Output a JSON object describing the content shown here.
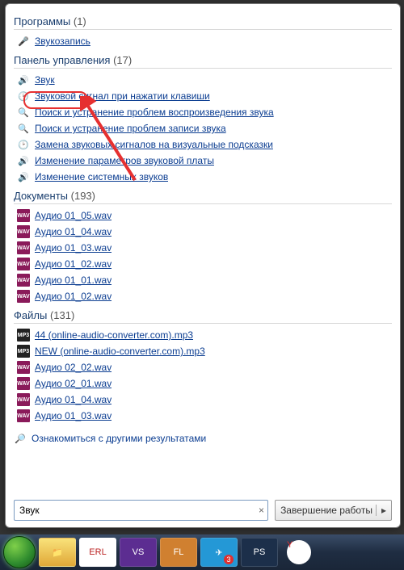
{
  "sections": {
    "programs": {
      "title": "Программы",
      "count": "(1)",
      "items": [
        {
          "icon": "mic",
          "label": "Звукозапись"
        }
      ]
    },
    "control_panel": {
      "title": "Панель управления",
      "count": "(17)",
      "items": [
        {
          "icon": "speaker",
          "label": "Звук"
        },
        {
          "icon": "clock",
          "label": "Звуковой сигнал при нажатии клавиши"
        },
        {
          "icon": "search",
          "label": "Поиск и устранение проблем воспроизведения звука"
        },
        {
          "icon": "search",
          "label": "Поиск и устранение проблем записи звука"
        },
        {
          "icon": "clock",
          "label": "Замена звуковых сигналов на визуальные подсказки"
        },
        {
          "icon": "speaker",
          "label": "Изменение параметров звуковой платы"
        },
        {
          "icon": "speaker",
          "label": "Изменение системных звуков"
        }
      ]
    },
    "documents": {
      "title": "Документы",
      "count": "(193)",
      "items": [
        {
          "icon": "wav",
          "label": "Аудио 01_05.wav"
        },
        {
          "icon": "wav",
          "label": "Аудио 01_04.wav"
        },
        {
          "icon": "wav",
          "label": "Аудио 01_03.wav"
        },
        {
          "icon": "wav",
          "label": "Аудио 01_02.wav"
        },
        {
          "icon": "wav",
          "label": "Аудио 01_01.wav"
        },
        {
          "icon": "wav",
          "label": "Аудио 01_02.wav"
        }
      ]
    },
    "files": {
      "title": "Файлы",
      "count": "(131)",
      "items": [
        {
          "icon": "mp3",
          "label": "44 (online-audio-converter.com).mp3"
        },
        {
          "icon": "mp3",
          "label": "NEW (online-audio-converter.com).mp3"
        },
        {
          "icon": "wav",
          "label": "Аудио 02_02.wav"
        },
        {
          "icon": "wav",
          "label": "Аудио 02_01.wav"
        },
        {
          "icon": "wav",
          "label": "Аудио 01_04.wav"
        },
        {
          "icon": "wav",
          "label": "Аудио 01_03.wav"
        }
      ]
    }
  },
  "more_results": "Ознакомиться с другими результатами",
  "search": {
    "value": "Звук",
    "clear": "×"
  },
  "shutdown": {
    "label": "Завершение работы",
    "arrow": "▸"
  },
  "taskbar": {
    "explorer": "",
    "erlang": "ERL",
    "vs": "VS",
    "fl": "FL",
    "tg": "TG",
    "tg_badge": "3",
    "ps": "PS",
    "yx": "Y"
  },
  "icon_glyph": {
    "mic": "🎤",
    "speaker": "🔊",
    "clock": "🕑",
    "search": "🔍",
    "wav": "WAV",
    "mp3": "MP3",
    "mag": "🔎"
  }
}
